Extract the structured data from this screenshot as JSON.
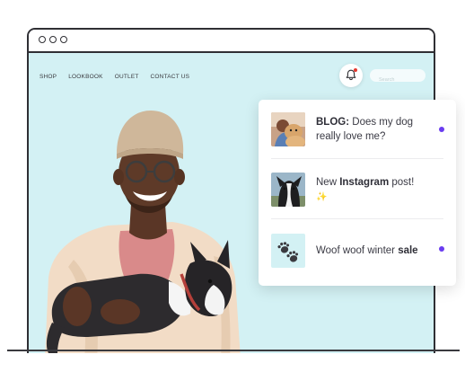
{
  "nav": {
    "items": [
      "SHOP",
      "LOOKBOOK",
      "OUTLET",
      "CONTACT US"
    ]
  },
  "search": {
    "placeholder": "Search"
  },
  "icons": {
    "bell": "bell-icon",
    "paw": "paw-icon",
    "sparkle": "sparkle-icon"
  },
  "colors": {
    "background": "#d3f1f4",
    "unread_dot": "#6a3cf0",
    "bell_badge": "#e4382f"
  },
  "notifications": [
    {
      "prefix": "BLOG:",
      "text": " Does my dog really love me?",
      "unread": true
    },
    {
      "text_before": "New ",
      "bold": "Instagram",
      "text_after": " post!",
      "emoji": "✨",
      "unread": true
    },
    {
      "text_before": "Woof woof winter ",
      "bold": "sale",
      "unread": false
    }
  ]
}
